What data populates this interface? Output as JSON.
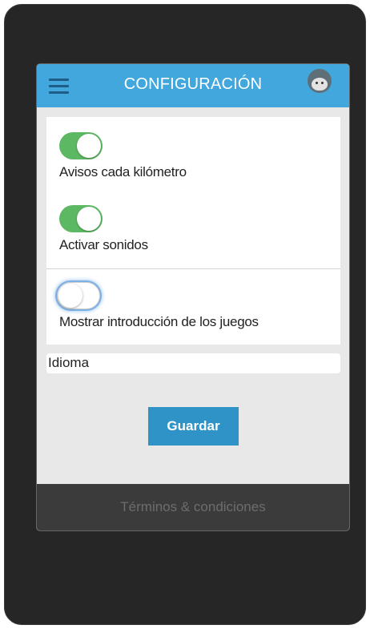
{
  "header": {
    "title": "CONFIGURACIÓN",
    "menu_icon": "hamburger-menu-icon",
    "avatar_icon": "user-avatar-icon"
  },
  "settings": [
    {
      "label": "Avisos cada kilómetro",
      "state": "on"
    },
    {
      "label": "Activar sonidos",
      "state": "on"
    },
    {
      "label": "Mostrar introducción de los juegos",
      "state": "off"
    }
  ],
  "language": {
    "value": "Idioma"
  },
  "actions": {
    "save_label": "Guardar"
  },
  "footer": {
    "terms_label": "Términos & condiciones"
  },
  "colors": {
    "header_bg": "#41a7dc",
    "toggle_on": "#5cb862",
    "save_button": "#2f93c7",
    "footer_bg": "#3b3b3b",
    "device_frame": "#262626"
  }
}
